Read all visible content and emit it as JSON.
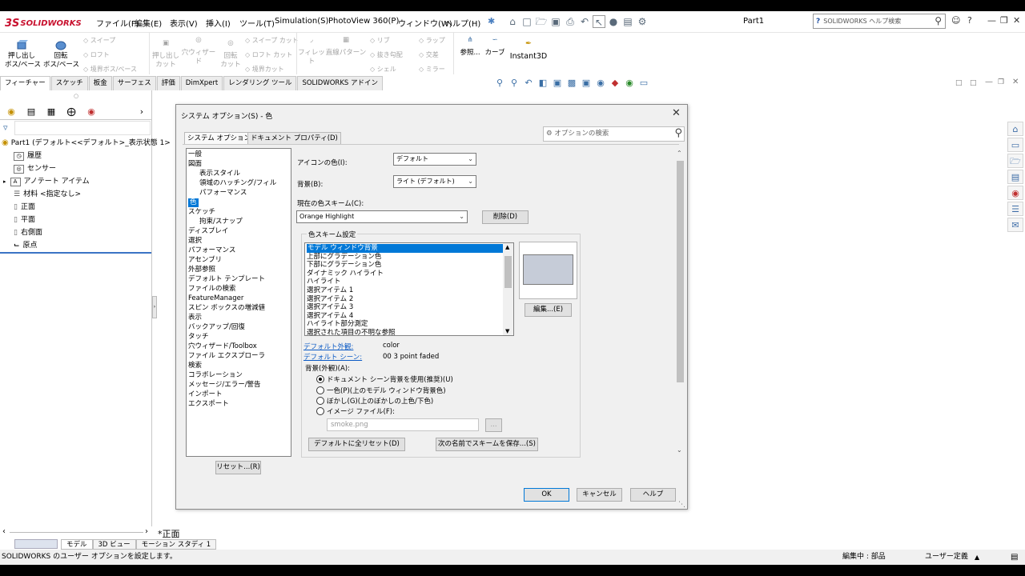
{
  "app": {
    "logo_mark": "3S",
    "logo_text": "SOLIDWORKS",
    "part_title": "Part1"
  },
  "menu": [
    "ファイル(F)",
    "編集(E)",
    "表示(V)",
    "挿入(I)",
    "ツール(T)",
    "Simulation(S)",
    "PhotoView 360(P)",
    "ウィンドウ(W)",
    "ヘルプ(H)"
  ],
  "search": {
    "placeholder": "SOLIDWORKS ヘルプ検索"
  },
  "ribbon": {
    "extrude_boss": "押し出し\nボス/ベース",
    "revolve_boss": "回転\nボス/ベース",
    "sweep": "スイープ",
    "loft": "ロフト",
    "boundary_boss": "境界ボス/ベース",
    "extrude_cut": "押し出し\nカット",
    "hole_wizard": "穴ウィザード",
    "revolve_cut": "回転\nカット",
    "sweep_cut": "スイープ カット",
    "loft_cut": "ロフト カット",
    "boundary_cut": "境界カット",
    "fillet": "フィレット",
    "linear_pattern": "直線パターン",
    "rib": "リブ",
    "draft": "抜き勾配",
    "shell": "シェル",
    "wrap": "ラップ",
    "intersect": "交差",
    "mirror": "ミラー",
    "reference": "参照...",
    "curves": "カーブ",
    "instant3d": "Instant3D"
  },
  "cmd_tabs": [
    "フィーチャー",
    "スケッチ",
    "板金",
    "サーフェス",
    "評価",
    "DimXpert",
    "レンダリング ツール",
    "SOLIDWORKS アドイン"
  ],
  "tree": {
    "root": "Part1 (デフォルト<<デフォルト>_表示状態 1>",
    "items": [
      "履歴",
      "センサー",
      "アノテート アイテム",
      "材料 <指定なし>",
      "正面",
      "平面",
      "右側面",
      "原点"
    ]
  },
  "bottom_tabs": [
    "モデル",
    "3D ビュー",
    "モーション スタディ 1"
  ],
  "view_label": "*正面",
  "status": {
    "left": "SOLIDWORKS のユーザー オプションを設定します。",
    "editing": "編集中 : 部品",
    "units": "ユーザー定義"
  },
  "dialog": {
    "title": "システム オプション(S) - 色",
    "tabs": [
      "システム オプション(S)",
      "ドキュメント プロパティ(D)"
    ],
    "search_placeholder": "オプションの検索",
    "categories": [
      {
        "label": "一般",
        "indent": 0
      },
      {
        "label": "図面",
        "indent": 0
      },
      {
        "label": "表示スタイル",
        "indent": 1
      },
      {
        "label": "領域のハッチング/フィル",
        "indent": 1
      },
      {
        "label": "パフォーマンス",
        "indent": 1
      },
      {
        "label": "色",
        "indent": 0,
        "selected": true
      },
      {
        "label": "スケッチ",
        "indent": 0
      },
      {
        "label": "拘束/スナップ",
        "indent": 1
      },
      {
        "label": "ディスプレイ",
        "indent": 0
      },
      {
        "label": "選択",
        "indent": 0
      },
      {
        "label": "パフォーマンス",
        "indent": 0
      },
      {
        "label": "アセンブリ",
        "indent": 0
      },
      {
        "label": "外部参照",
        "indent": 0
      },
      {
        "label": "デフォルト テンプレート",
        "indent": 0
      },
      {
        "label": "ファイルの検索",
        "indent": 0
      },
      {
        "label": "FeatureManager",
        "indent": 0
      },
      {
        "label": "スピン ボックスの増減値",
        "indent": 0
      },
      {
        "label": "表示",
        "indent": 0
      },
      {
        "label": "バックアップ/回復",
        "indent": 0
      },
      {
        "label": "タッチ",
        "indent": 0
      },
      {
        "label": "穴ウィザード/Toolbox",
        "indent": 0
      },
      {
        "label": "ファイル エクスプローラ",
        "indent": 0
      },
      {
        "label": "検索",
        "indent": 0
      },
      {
        "label": "コラボレーション",
        "indent": 0
      },
      {
        "label": "メッセージ/エラー/警告",
        "indent": 0
      },
      {
        "label": "インポート",
        "indent": 0
      },
      {
        "label": "エクスポート",
        "indent": 0
      }
    ],
    "icon_color_label": "アイコンの色(I):",
    "icon_color_value": "デフォルト",
    "background_label": "背景(B):",
    "background_value": "ライト (デフォルト)",
    "scheme_label": "現在の色スキーム(C):",
    "scheme_value": "Orange Highlight",
    "delete_button": "削除(D)",
    "scheme_group": "色スキーム設定",
    "scheme_items": [
      "モデル ウィンドウ背景",
      "上部にグラデーション色",
      "下部にグラデーション色",
      "ダイナミック ハイライト",
      "ハイライト",
      "選択アイテム 1",
      "選択アイテム 2",
      "選択アイテム 3",
      "選択アイテム 4",
      "ハイライト部分測定",
      "選択された項目の不明な参照"
    ],
    "edit_button": "編集...(E)",
    "default_appearance_link": "デフォルト外観:",
    "default_appearance_value": "color",
    "default_scene_link": "デフォルト シーン:",
    "default_scene_value": "00 3 point faded",
    "bg_appearance_label": "背景(外観)(A):",
    "radios": [
      {
        "label": "ドキュメント シーン背景を使用(推奨)(U)",
        "checked": true
      },
      {
        "label": "一色(P)(上のモデル ウィンドウ背景色)",
        "checked": false
      },
      {
        "label": "ぼかし(G)(上のぼかしの上色/下色)",
        "checked": false
      },
      {
        "label": "イメージ ファイル(F):",
        "checked": false
      }
    ],
    "image_file_placeholder": "smoke.png",
    "browse_button": "...",
    "reset_all_button": "デフォルトに全リセット(D)",
    "save_scheme_button": "次の名前でスキームを保存...(S)",
    "reset_button": "リセット...(R)",
    "ok_button": "OK",
    "cancel_button": "キャンセル",
    "help_button": "ヘルプ"
  },
  "colors": {
    "selection": "#0078d7",
    "brand": "#c8102e",
    "accent_line": "#3b74c5",
    "swatch": "#c6ccd8"
  }
}
